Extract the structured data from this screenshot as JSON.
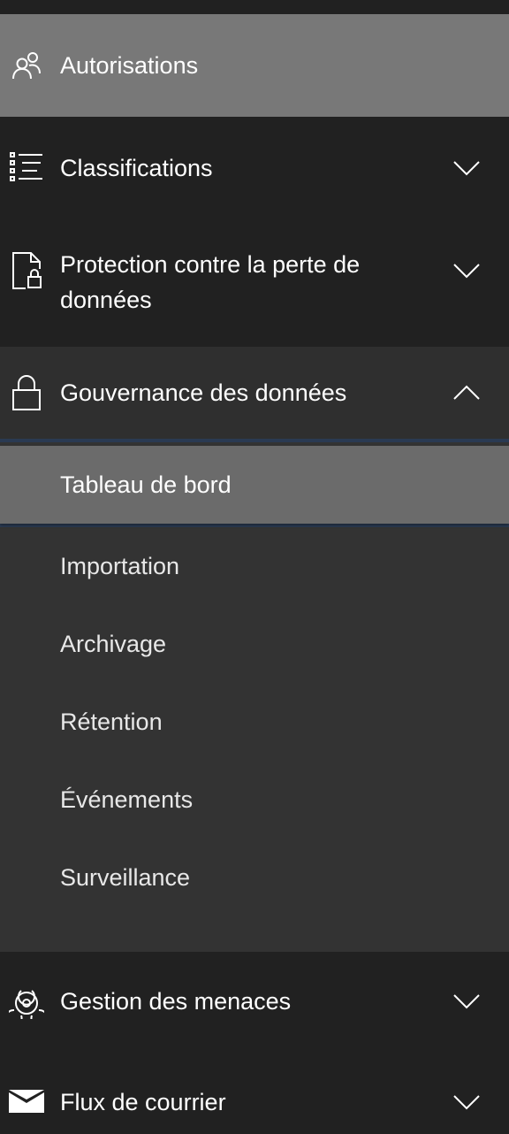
{
  "nav": {
    "items": [
      {
        "label": "Autorisations",
        "icon": "people-icon",
        "has_chevron": false,
        "selected": true
      },
      {
        "label": "Classifications",
        "icon": "list-icon",
        "chevron": "chevron-down-icon"
      },
      {
        "label": "Protection contre la perte de données",
        "icon": "document-lock-icon",
        "chevron": "chevron-down-icon"
      },
      {
        "label": "Gouvernance des données",
        "icon": "lock-icon",
        "chevron": "chevron-up-icon",
        "expanded": true
      },
      {
        "label": "Gestion des menaces",
        "icon": "biohazard-icon",
        "chevron": "chevron-down-icon"
      },
      {
        "label": "Flux de courrier",
        "icon": "mail-icon",
        "chevron": "chevron-down-icon"
      }
    ],
    "governance_sub": [
      {
        "label": "Tableau de bord",
        "active": true
      },
      {
        "label": "Importation"
      },
      {
        "label": "Archivage"
      },
      {
        "label": "Rétention"
      },
      {
        "label": "Événements"
      },
      {
        "label": "Surveillance"
      }
    ]
  },
  "colors": {
    "background": "#212121",
    "selected": "#787878",
    "expanded_group": "#2f2f2f",
    "submenu": "#333333",
    "submenu_active": "#6b6b6b",
    "divider": "#2a3a52",
    "text": "#ffffff"
  }
}
